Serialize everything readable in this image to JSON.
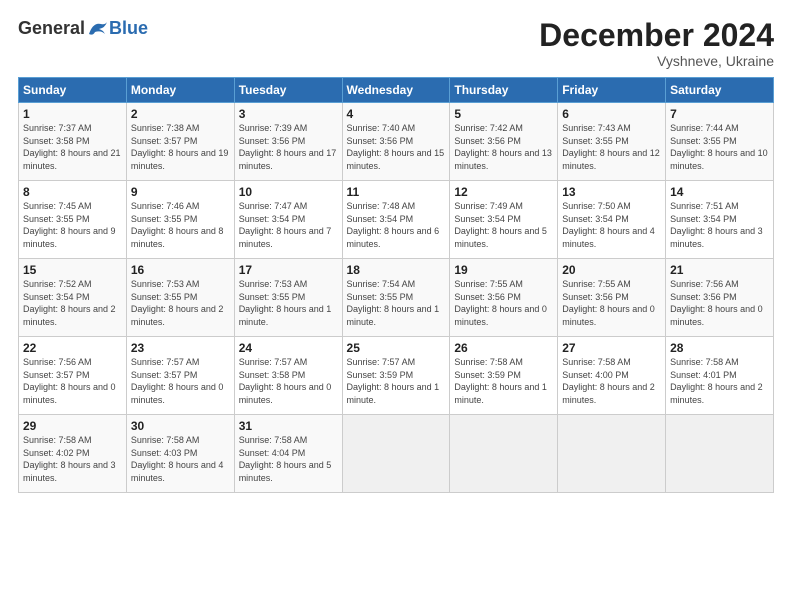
{
  "logo": {
    "general": "General",
    "blue": "Blue"
  },
  "title": "December 2024",
  "subtitle": "Vyshneve, Ukraine",
  "days_of_week": [
    "Sunday",
    "Monday",
    "Tuesday",
    "Wednesday",
    "Thursday",
    "Friday",
    "Saturday"
  ],
  "weeks": [
    [
      {
        "day": "1",
        "sunrise": "7:37 AM",
        "sunset": "3:58 PM",
        "daylight": "8 hours and 21 minutes."
      },
      {
        "day": "2",
        "sunrise": "7:38 AM",
        "sunset": "3:57 PM",
        "daylight": "8 hours and 19 minutes."
      },
      {
        "day": "3",
        "sunrise": "7:39 AM",
        "sunset": "3:56 PM",
        "daylight": "8 hours and 17 minutes."
      },
      {
        "day": "4",
        "sunrise": "7:40 AM",
        "sunset": "3:56 PM",
        "daylight": "8 hours and 15 minutes."
      },
      {
        "day": "5",
        "sunrise": "7:42 AM",
        "sunset": "3:56 PM",
        "daylight": "8 hours and 13 minutes."
      },
      {
        "day": "6",
        "sunrise": "7:43 AM",
        "sunset": "3:55 PM",
        "daylight": "8 hours and 12 minutes."
      },
      {
        "day": "7",
        "sunrise": "7:44 AM",
        "sunset": "3:55 PM",
        "daylight": "8 hours and 10 minutes."
      }
    ],
    [
      {
        "day": "8",
        "sunrise": "7:45 AM",
        "sunset": "3:55 PM",
        "daylight": "8 hours and 9 minutes."
      },
      {
        "day": "9",
        "sunrise": "7:46 AM",
        "sunset": "3:55 PM",
        "daylight": "8 hours and 8 minutes."
      },
      {
        "day": "10",
        "sunrise": "7:47 AM",
        "sunset": "3:54 PM",
        "daylight": "8 hours and 7 minutes."
      },
      {
        "day": "11",
        "sunrise": "7:48 AM",
        "sunset": "3:54 PM",
        "daylight": "8 hours and 6 minutes."
      },
      {
        "day": "12",
        "sunrise": "7:49 AM",
        "sunset": "3:54 PM",
        "daylight": "8 hours and 5 minutes."
      },
      {
        "day": "13",
        "sunrise": "7:50 AM",
        "sunset": "3:54 PM",
        "daylight": "8 hours and 4 minutes."
      },
      {
        "day": "14",
        "sunrise": "7:51 AM",
        "sunset": "3:54 PM",
        "daylight": "8 hours and 3 minutes."
      }
    ],
    [
      {
        "day": "15",
        "sunrise": "7:52 AM",
        "sunset": "3:54 PM",
        "daylight": "8 hours and 2 minutes."
      },
      {
        "day": "16",
        "sunrise": "7:53 AM",
        "sunset": "3:55 PM",
        "daylight": "8 hours and 2 minutes."
      },
      {
        "day": "17",
        "sunrise": "7:53 AM",
        "sunset": "3:55 PM",
        "daylight": "8 hours and 1 minute."
      },
      {
        "day": "18",
        "sunrise": "7:54 AM",
        "sunset": "3:55 PM",
        "daylight": "8 hours and 1 minute."
      },
      {
        "day": "19",
        "sunrise": "7:55 AM",
        "sunset": "3:56 PM",
        "daylight": "8 hours and 0 minutes."
      },
      {
        "day": "20",
        "sunrise": "7:55 AM",
        "sunset": "3:56 PM",
        "daylight": "8 hours and 0 minutes."
      },
      {
        "day": "21",
        "sunrise": "7:56 AM",
        "sunset": "3:56 PM",
        "daylight": "8 hours and 0 minutes."
      }
    ],
    [
      {
        "day": "22",
        "sunrise": "7:56 AM",
        "sunset": "3:57 PM",
        "daylight": "8 hours and 0 minutes."
      },
      {
        "day": "23",
        "sunrise": "7:57 AM",
        "sunset": "3:57 PM",
        "daylight": "8 hours and 0 minutes."
      },
      {
        "day": "24",
        "sunrise": "7:57 AM",
        "sunset": "3:58 PM",
        "daylight": "8 hours and 0 minutes."
      },
      {
        "day": "25",
        "sunrise": "7:57 AM",
        "sunset": "3:59 PM",
        "daylight": "8 hours and 1 minute."
      },
      {
        "day": "26",
        "sunrise": "7:58 AM",
        "sunset": "3:59 PM",
        "daylight": "8 hours and 1 minute."
      },
      {
        "day": "27",
        "sunrise": "7:58 AM",
        "sunset": "4:00 PM",
        "daylight": "8 hours and 2 minutes."
      },
      {
        "day": "28",
        "sunrise": "7:58 AM",
        "sunset": "4:01 PM",
        "daylight": "8 hours and 2 minutes."
      }
    ],
    [
      {
        "day": "29",
        "sunrise": "7:58 AM",
        "sunset": "4:02 PM",
        "daylight": "8 hours and 3 minutes."
      },
      {
        "day": "30",
        "sunrise": "7:58 AM",
        "sunset": "4:03 PM",
        "daylight": "8 hours and 4 minutes."
      },
      {
        "day": "31",
        "sunrise": "7:58 AM",
        "sunset": "4:04 PM",
        "daylight": "8 hours and 5 minutes."
      },
      null,
      null,
      null,
      null
    ]
  ],
  "labels": {
    "sunrise": "Sunrise:",
    "sunset": "Sunset:",
    "daylight": "Daylight:"
  }
}
